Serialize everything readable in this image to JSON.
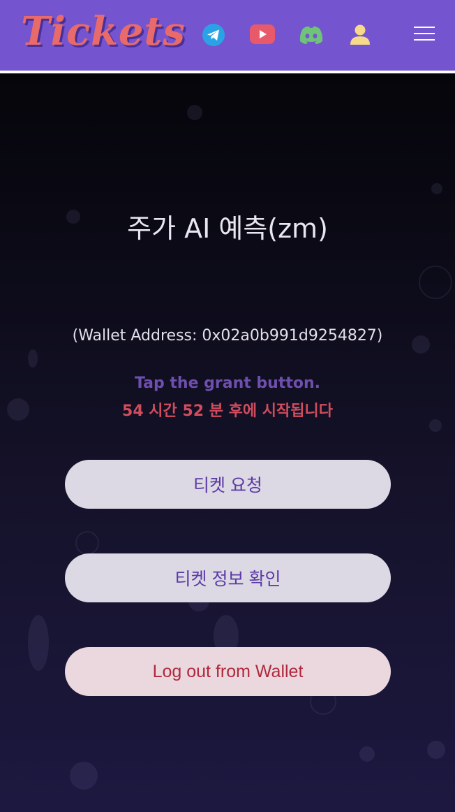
{
  "header": {
    "logo_text": "Tickets",
    "icons": [
      {
        "name": "telegram-icon",
        "color": "#2aa3e6"
      },
      {
        "name": "youtube-icon",
        "color": "#e85a6a"
      },
      {
        "name": "discord-icon",
        "color": "#6fc47a"
      },
      {
        "name": "user-icon",
        "color": "#f7d98b"
      },
      {
        "name": "hamburger-menu-icon",
        "color": "#ffffff"
      }
    ],
    "background": "#7455cf"
  },
  "main": {
    "title": "주가 AI 예측(zm)",
    "wallet_address": "(Wallet Address: 0x02a0b991d9254827)",
    "grant_hint": "Tap the grant button.",
    "countdown": "54 시간 52 분 후에 시작됩니다",
    "buttons": {
      "request_ticket": "티켓 요청",
      "ticket_info": "티켓 정보 확인",
      "logout": "Log out from Wallet"
    }
  },
  "colors": {
    "accent_purple": "#6e4fae",
    "countdown_red": "#d04d5e",
    "logout_red": "#b0283c"
  }
}
